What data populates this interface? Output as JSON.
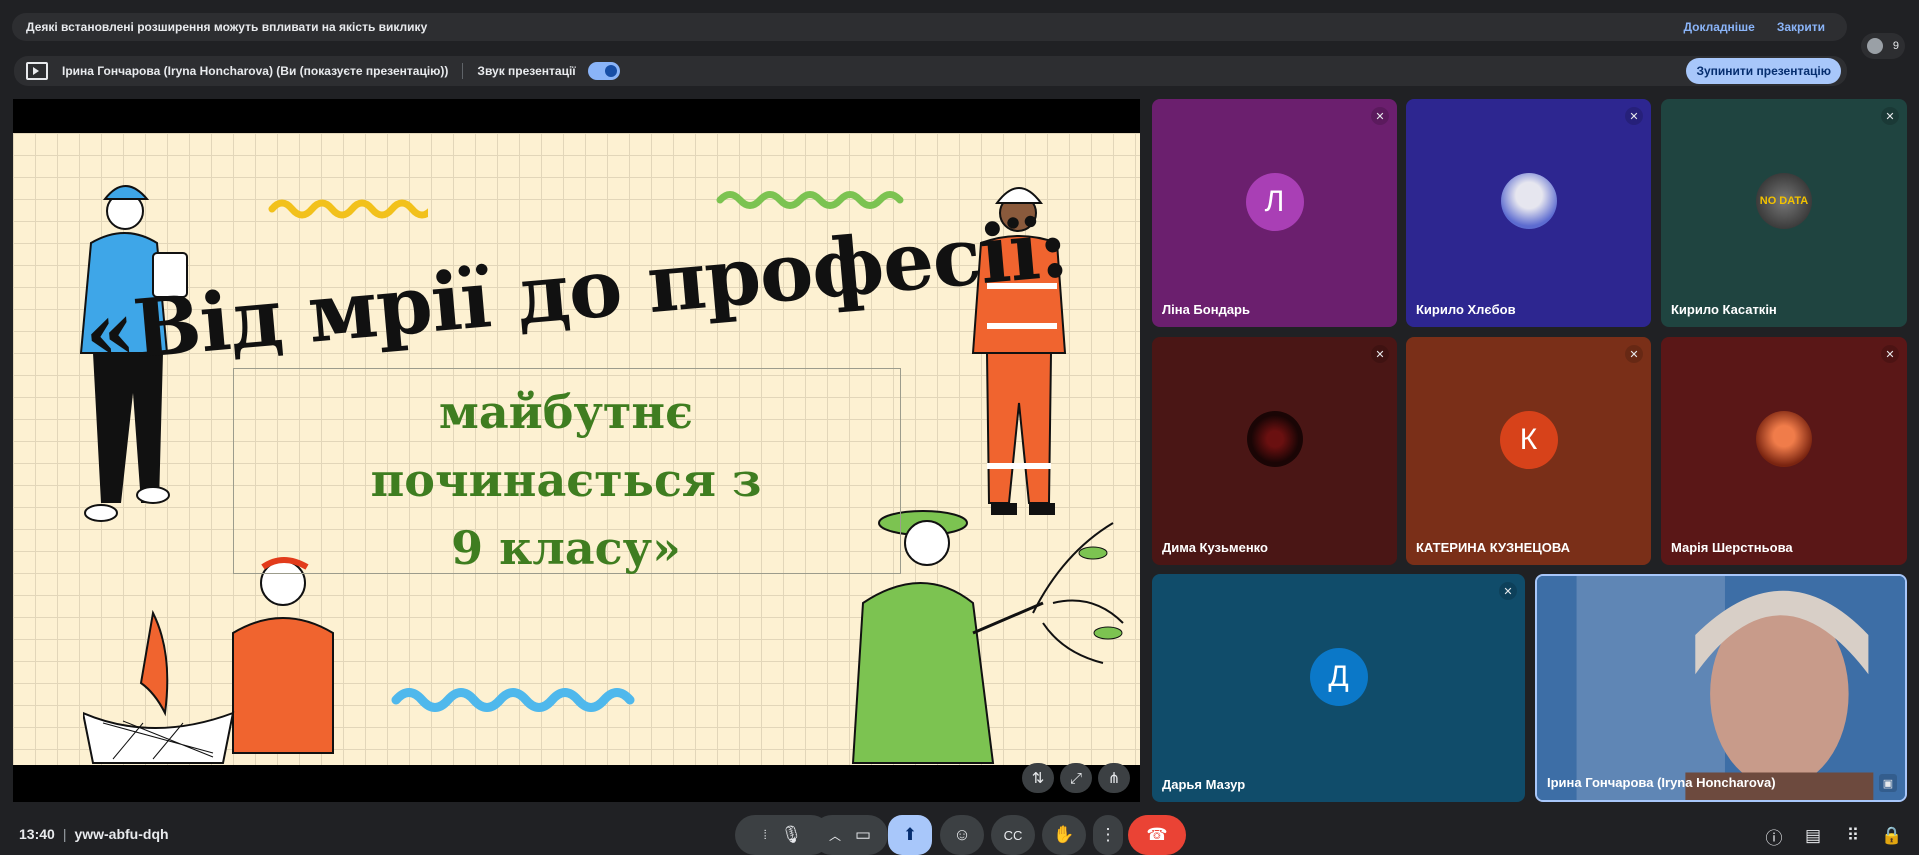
{
  "warning": {
    "text": "Деякі встановлені розширення можуть впливати на якість виклику",
    "details": "Докладніше",
    "close": "Закрити"
  },
  "presenting": {
    "who": "Ірина Гончарова (Iryna Honcharova) (Ви (показуєте презентацію))",
    "sound_label": "Звук презентації",
    "stop": "Зупинити презентацію"
  },
  "people_count": "9",
  "slide": {
    "title": "«Від мрії до професії:",
    "subtitle": [
      "майбутнє",
      "починається з",
      "9 класу»"
    ]
  },
  "participants": [
    {
      "name": "Ліна Бондарь",
      "initial": "Л",
      "bg": "#6b1f6e",
      "avatar": "#a93fb5"
    },
    {
      "name": "Кирило Хлєбов",
      "initial": "",
      "bg": "#2d2690",
      "avatar": "image"
    },
    {
      "name": "Кирило Касаткін",
      "initial": "",
      "bg": "#1f4440",
      "avatar": "nodata",
      "avatar_text": "NO DATA"
    },
    {
      "name": "Дима Кузьменко",
      "initial": "",
      "bg": "#4a1615",
      "avatar": "image"
    },
    {
      "name": "КАТЕРИНА КУЗНЕЦОВА",
      "initial": "К",
      "bg": "#7a2f18",
      "avatar": "#d7421a"
    },
    {
      "name": "Марія Шерстньова",
      "initial": "",
      "bg": "#5a1717",
      "avatar": "image"
    },
    {
      "name": "Дарья Мазур",
      "initial": "Д",
      "bg": "#104c6a",
      "avatar": "#0b78c8"
    },
    {
      "name": "Ірина Гончарова (Iryna Honcharova)",
      "initial": "",
      "bg": "#2a5d93",
      "avatar": "video"
    }
  ],
  "meeting": {
    "time": "13:40",
    "code": "yww-abfu-dqh"
  },
  "colors": {
    "accent": "#a8c7fa",
    "end_call": "#ea4335",
    "background": "#202124"
  }
}
